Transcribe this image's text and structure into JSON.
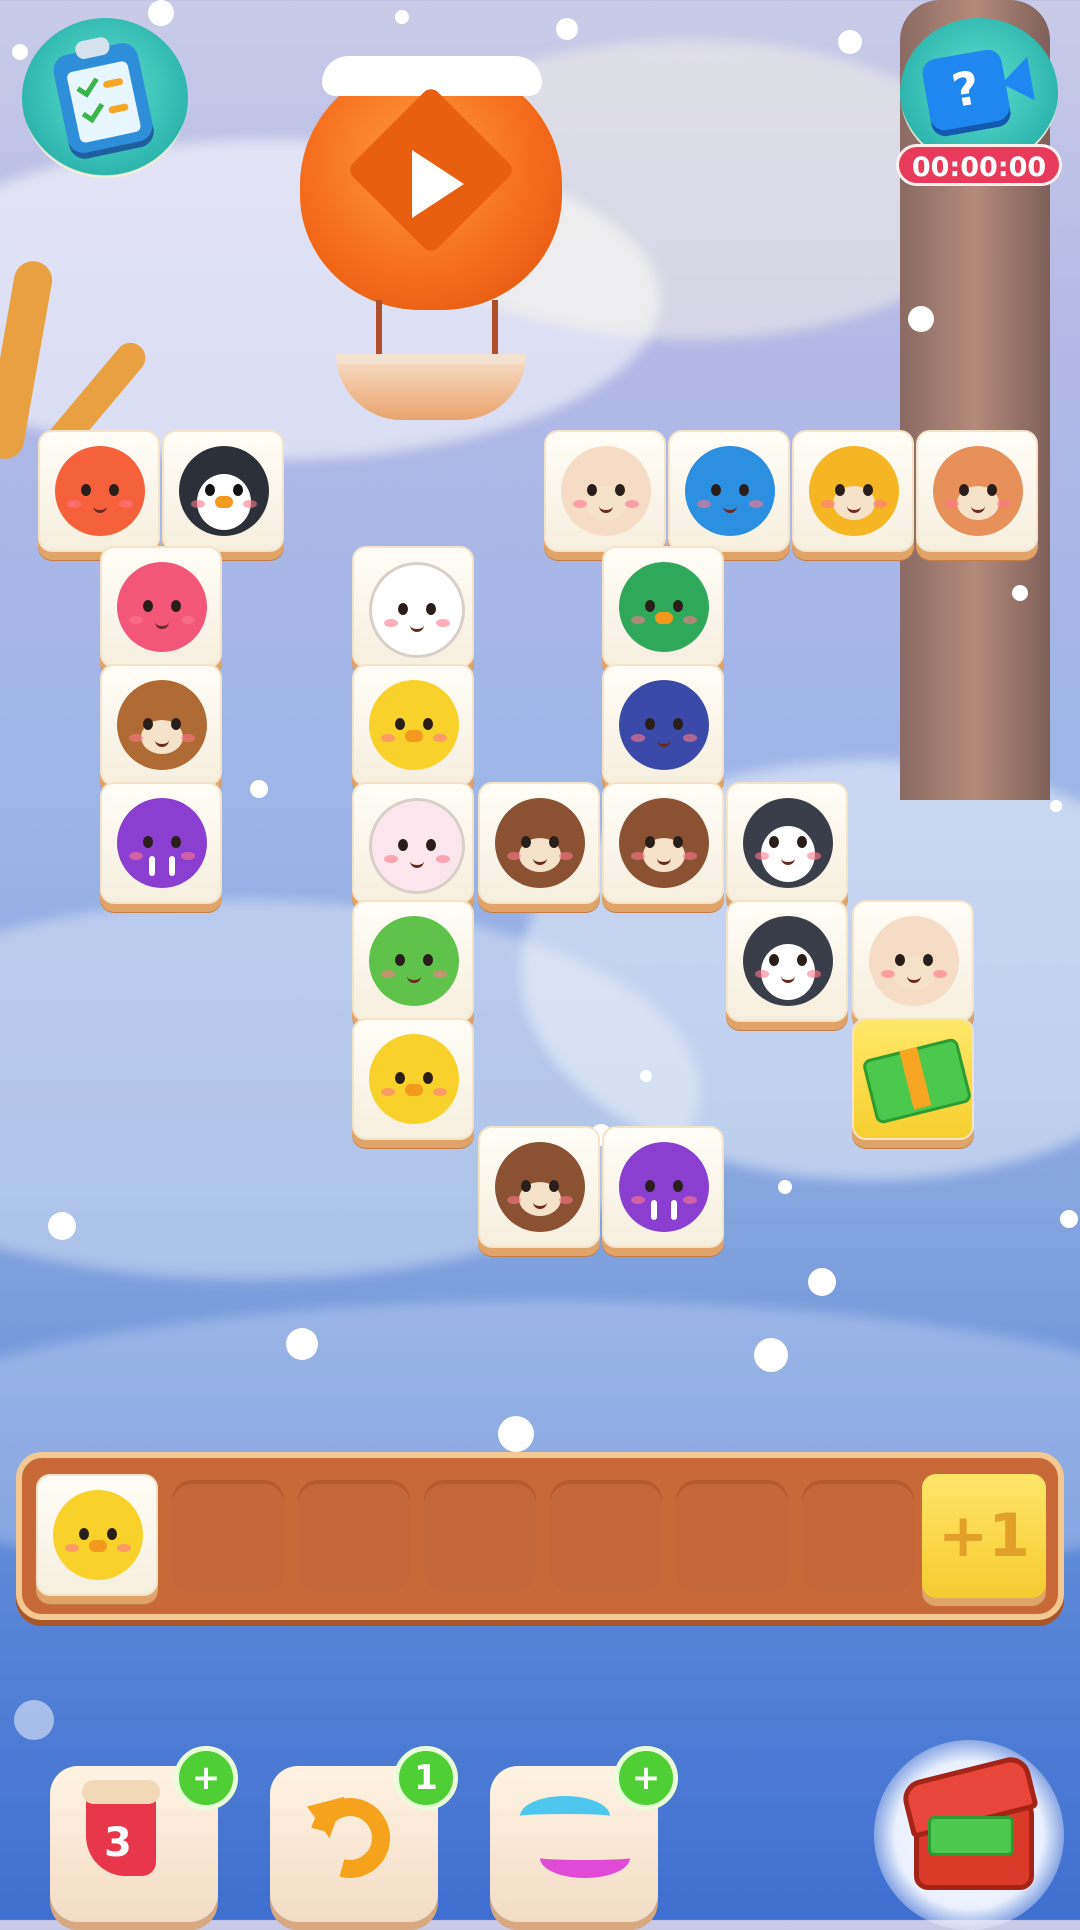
{
  "hud": {
    "timer": "00:00:00",
    "video_hint_glyph": "?",
    "icons": {
      "task": "clipboard-checklist-icon",
      "video": "video-camera-question-icon",
      "balloon_play": "play-icon"
    }
  },
  "board": {
    "tiles": [
      {
        "animal": "fox",
        "color": "#f4613a"
      },
      {
        "animal": "penguin",
        "color": "#2c3038"
      },
      {
        "animal": "sheep",
        "color": "#f6dcc4"
      },
      {
        "animal": "hippo",
        "color": "#2d8fe0"
      },
      {
        "animal": "lion",
        "color": "#f6b624"
      },
      {
        "animal": "deer",
        "color": "#e8905a"
      },
      {
        "animal": "pink-bear",
        "color": "#f2577a"
      },
      {
        "animal": "panda",
        "color": "#ffffff"
      },
      {
        "animal": "duck",
        "color": "#2fa85a"
      },
      {
        "animal": "monkey",
        "color": "#b06a34"
      },
      {
        "animal": "chick",
        "color": "#f8d22a"
      },
      {
        "animal": "elephant",
        "color": "#3b4aa8"
      },
      {
        "animal": "walrus",
        "color": "#8a3fd0"
      },
      {
        "animal": "rabbit",
        "color": "#fbe6ee"
      },
      {
        "animal": "bear",
        "color": "#8a5232"
      },
      {
        "animal": "bear",
        "color": "#8a5232"
      },
      {
        "animal": "husky",
        "color": "#3a3e48"
      },
      {
        "animal": "frog",
        "color": "#5fc24a"
      },
      {
        "animal": "husky",
        "color": "#3a3e48"
      },
      {
        "animal": "sheep",
        "color": "#f6dcc4"
      },
      {
        "animal": "chick",
        "color": "#f8d22a"
      },
      {
        "animal": "cash-bonus",
        "color": "#4cc94c"
      },
      {
        "animal": "bear",
        "color": "#8a5232"
      },
      {
        "animal": "walrus",
        "color": "#8a3fd0"
      }
    ]
  },
  "tray": {
    "slot_count": 7,
    "filled": [
      {
        "animal": "chick",
        "color": "#f8d22a"
      }
    ],
    "extra_slot_label": "+1"
  },
  "boosters": [
    {
      "name": "sock",
      "count_label": "3",
      "badge": "+",
      "icon": "christmas-sock-icon"
    },
    {
      "name": "undo",
      "badge": "1",
      "icon": "undo-arrow-icon"
    },
    {
      "name": "shuffle",
      "badge": "+",
      "icon": "shuffle-arrows-icon"
    }
  ],
  "reward": {
    "icon": "treasure-chest-cash-icon"
  }
}
